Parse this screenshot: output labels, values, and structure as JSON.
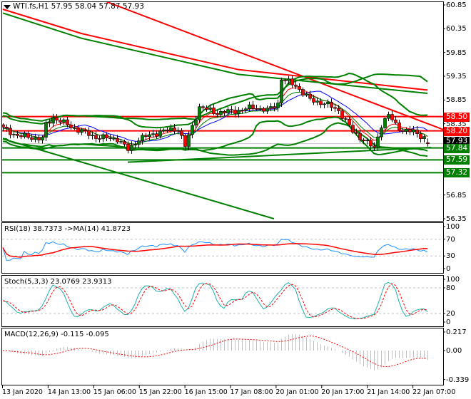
{
  "symbol_header": "WTI.fs,H1  57.95 58.04 57.87 57.93",
  "price_axis": [
    "60.85",
    "60.35",
    "59.85",
    "59.35",
    "58.85",
    "58.35",
    "56.85",
    "56.35"
  ],
  "price_boxes": [
    {
      "label": "58.50",
      "color": "#ff0000"
    },
    {
      "label": "58.20",
      "color": "#ff0000"
    },
    {
      "label": "57.93",
      "color": "#000000"
    },
    {
      "label": "57.84",
      "color": "#008000"
    },
    {
      "label": "57.59",
      "color": "#008000"
    },
    {
      "label": "57.32",
      "color": "#008000"
    }
  ],
  "time_axis": [
    "13 Jan 2020",
    "14 Jan 13:00",
    "15 Jan 06:00",
    "15 Jan 22:00",
    "16 Jan 15:00",
    "17 Jan 08:00",
    "20 Jan 01:00",
    "20 Jan 17:00",
    "21 Jan 14:00",
    "22 Jan 07:00"
  ],
  "rsi": {
    "title": "RSI(18) 38.7373  ->MA(14) 41.8723",
    "levels": [
      "100",
      "70",
      "30",
      "0"
    ]
  },
  "stoch": {
    "title": "Stoch(5,3,3) 23.0769 23.9313",
    "levels": [
      "100",
      "80",
      "20",
      "0"
    ]
  },
  "macd": {
    "title": "MACD(12,26,9) -0.115 -0.095",
    "levels": [
      "0.217",
      "0.00",
      "-0.339"
    ]
  },
  "colors": {
    "bull": "#008000",
    "bear": "#ff0000",
    "band": "#008000",
    "resistance": "#ff0000",
    "support": "#008000",
    "ma_fast": "#ff0000",
    "ma_slow": "#0000ff",
    "rsi": "#1e90ff",
    "stoch_main": "#20b2aa",
    "signal": "#ff0000",
    "hist": "#c0c0c0"
  },
  "chart_data": {
    "type": "candlestick",
    "symbol": "WTI.fs",
    "timeframe": "H1",
    "last_ohlc": {
      "open": 57.95,
      "high": 58.04,
      "low": 57.87,
      "close": 57.93
    },
    "ylim": [
      56.35,
      60.85
    ],
    "close_keypoints": [
      [
        0,
        58.25
      ],
      [
        4,
        58.1
      ],
      [
        11,
        58.03
      ],
      [
        12,
        58.33
      ],
      [
        14,
        58.48
      ],
      [
        20,
        58.25
      ],
      [
        26,
        58.07
      ],
      [
        32,
        58.03
      ],
      [
        35,
        57.8
      ],
      [
        38,
        58.03
      ],
      [
        44,
        58.18
      ],
      [
        49,
        58.25
      ],
      [
        51,
        57.88
      ],
      [
        53,
        58.3
      ],
      [
        55,
        58.7
      ],
      [
        60,
        58.58
      ],
      [
        66,
        58.63
      ],
      [
        70,
        58.7
      ],
      [
        74,
        58.63
      ],
      [
        77,
        58.78
      ],
      [
        78,
        59.3
      ],
      [
        82,
        59.15
      ],
      [
        84,
        59.0
      ],
      [
        86,
        58.85
      ],
      [
        90,
        58.78
      ],
      [
        94,
        58.63
      ],
      [
        98,
        58.18
      ],
      [
        102,
        57.95
      ],
      [
        104,
        57.83
      ],
      [
        106,
        58.33
      ],
      [
        108,
        58.53
      ],
      [
        110,
        58.33
      ],
      [
        112,
        58.21
      ],
      [
        115,
        58.18
      ],
      [
        118,
        58.06
      ],
      [
        119,
        57.93
      ]
    ],
    "horizontal_levels": [
      58.5,
      58.2,
      57.84,
      57.59,
      57.32
    ],
    "trendlines": [
      {
        "color": "resistance",
        "points": [
          [
            29,
            60.92
          ],
          [
            124,
            58.21
          ]
        ]
      },
      {
        "color": "resistance",
        "points": [
          [
            0,
            60.76
          ],
          [
            22,
            60.25
          ],
          [
            66,
            59.49
          ],
          [
            119,
            59.06
          ]
        ]
      },
      {
        "color": "support",
        "points": [
          [
            0,
            60.68
          ],
          [
            22,
            60.15
          ],
          [
            66,
            59.39
          ],
          [
            119,
            58.99
          ]
        ]
      },
      {
        "color": "support",
        "points": [
          [
            0,
            58.03
          ],
          [
            76,
            56.35
          ]
        ]
      },
      {
        "color": "support",
        "points": [
          [
            35,
            57.54
          ],
          [
            66,
            57.65
          ],
          [
            120,
            57.85
          ]
        ]
      }
    ]
  }
}
